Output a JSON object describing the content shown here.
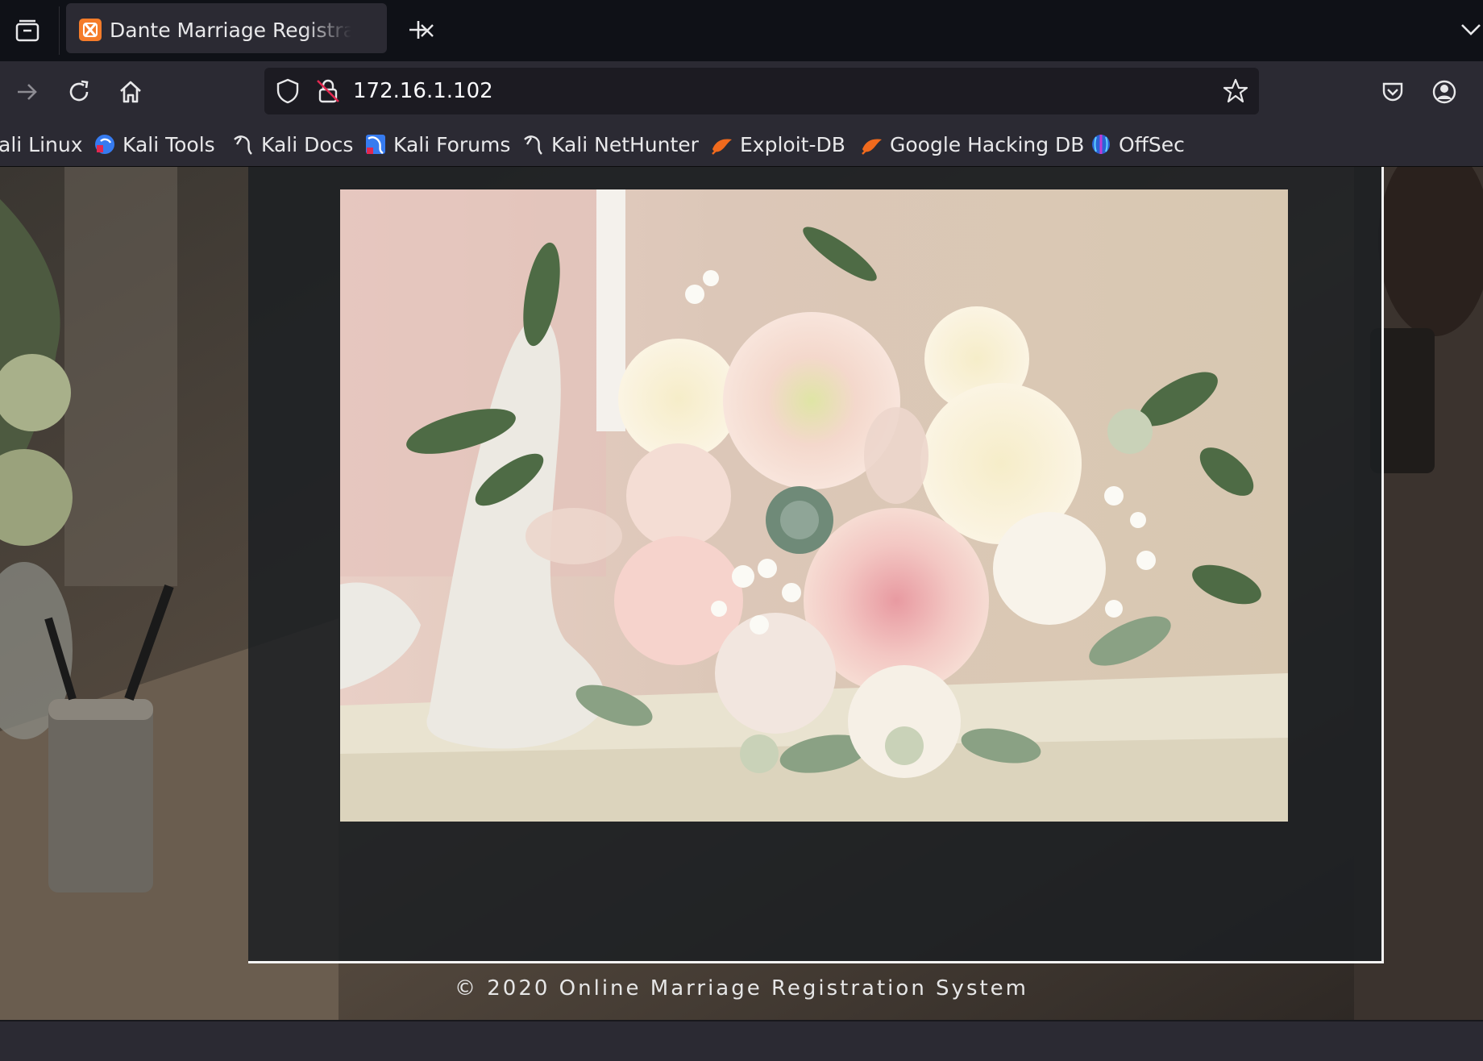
{
  "browser": {
    "tab": {
      "title": "Dante Marriage Registration",
      "favicon": "xampp-icon"
    },
    "url": "172.16.1.102",
    "bookmarks": [
      {
        "label": "ali Linux",
        "icon": "kali-icon"
      },
      {
        "label": "Kali Tools",
        "icon": "kali-tools-icon"
      },
      {
        "label": "Kali Docs",
        "icon": "kali-dragon-icon"
      },
      {
        "label": "Kali Forums",
        "icon": "kali-forums-icon"
      },
      {
        "label": "Kali NetHunter",
        "icon": "kali-dragon-icon"
      },
      {
        "label": "Exploit-DB",
        "icon": "exploit-db-icon"
      },
      {
        "label": "Google Hacking DB",
        "icon": "exploit-db-icon"
      },
      {
        "label": "OffSec",
        "icon": "offsec-icon"
      }
    ]
  },
  "page": {
    "footer": "© 2020 Online Marriage Registration System"
  },
  "colors": {
    "tabstrip": "#0f1117",
    "toolbar": "#2b2a33",
    "urlbar": "#1c1b22",
    "panel": "#1c1f23",
    "accent_favicon": "#f57c2a"
  }
}
